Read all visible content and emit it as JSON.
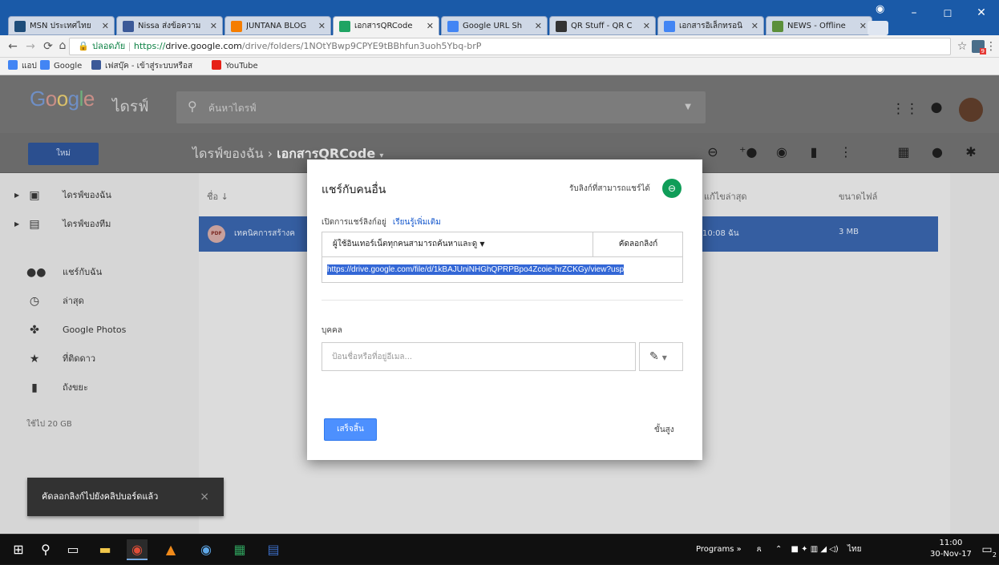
{
  "browser": {
    "tabs": [
      {
        "title": "MSN ประเทศไทย",
        "icon": "msn-icon",
        "color": "#1e4d7a"
      },
      {
        "title": "Nissa ส่งข้อความ",
        "icon": "facebook-icon",
        "color": "#3b5998"
      },
      {
        "title": "JUNTANA BLOG",
        "icon": "blogger-icon",
        "color": "#f57d00"
      },
      {
        "title": "เอกสารQRCode",
        "icon": "google-drive-icon",
        "color": "#1fa463",
        "active": true
      },
      {
        "title": "Google URL Sh",
        "icon": "google-icon",
        "color": "#4285f4"
      },
      {
        "title": "QR Stuff - QR C",
        "icon": "qrstuff-icon",
        "color": "#333333"
      },
      {
        "title": "เอกสารอิเล็กทรอนิ",
        "icon": "google-icon",
        "color": "#4285f4"
      },
      {
        "title": "NEWS - Offline",
        "icon": "news-icon",
        "color": "#5b8f3a"
      }
    ],
    "url": {
      "secure_label": "ปลอดภัย",
      "scheme": "https://",
      "host": "drive.google.com",
      "path": "/drive/folders/1NOtYBwp9CPYE9tBBhfun3uoh5Ybq-brP"
    },
    "bookmarks": [
      {
        "label": "แอป",
        "icon": "apps-grid-icon",
        "color": "#4285f4"
      },
      {
        "label": "Google",
        "icon": "google-icon",
        "color": "#4285f4"
      },
      {
        "label": "เฟสบุ๊ค - เข้าสู่ระบบหรือส",
        "icon": "facebook-icon",
        "color": "#3b5998"
      },
      {
        "label": "YouTube",
        "icon": "youtube-icon",
        "color": "#e62117"
      }
    ]
  },
  "drive": {
    "brand": "ไดรฟ์",
    "logo": {
      "g": "G",
      "o1": "o",
      "o2": "o",
      "g2": "g",
      "l": "l",
      "e": "e"
    },
    "search_placeholder": "ค้นหาไดรฟ์",
    "new_button": "ใหม่",
    "breadcrumb_root": "ไดรฟ์ของฉัน",
    "breadcrumb_sep": "›",
    "breadcrumb_current": "เอกสารQRCode",
    "sidebar": [
      {
        "label": "ไดรฟ์ของฉัน",
        "icon": "my-drive-icon",
        "expand": true
      },
      {
        "label": "ไดรฟ์ของทีม",
        "icon": "team-drive-icon",
        "expand": true
      },
      {
        "label": "แชร์กับฉัน",
        "icon": "shared-with-me-icon"
      },
      {
        "label": "ล่าสุด",
        "icon": "recent-clock-icon"
      },
      {
        "label": "Google Photos",
        "icon": "google-photos-icon"
      },
      {
        "label": "ที่ติดดาว",
        "icon": "starred-icon"
      },
      {
        "label": "ถังขยะ",
        "icon": "trash-icon"
      }
    ],
    "storage": "ใช้ไป 20 GB",
    "columns": {
      "name": "ชื่อ",
      "sort_arrow": "↓",
      "modified": "แก้ไขล่าสุด",
      "size": "ขนาดไฟล์"
    },
    "file": {
      "name": "เทคนิคการสร้างค",
      "type_badge": "PDF",
      "modified": "10:08 ฉัน",
      "size": "3 MB"
    },
    "toast": {
      "message": "คัดลอกลิงก์ไปยังคลิปบอร์ดแล้ว",
      "close": "×"
    }
  },
  "dialog": {
    "title": "แชร์กับคนอื่น",
    "get_link": "รับลิงก์ที่สามารถแชร์ได้",
    "share_state": "เปิดการแชร์ลิงก์อยู่",
    "learn_more": "เรียนรู้เพิ่มเติม",
    "access_option": "ผู้ใช้อินเทอร์เน็ตทุกคนสามารถค้นหาและดู",
    "copy_link": "คัดลอกลิงก์",
    "share_url": "https://drive.google.com/file/d/1kBAJUniNHGhQPRPBpo4Zcoie-hrZCKGy/view?usp",
    "people_label": "บุคคล",
    "people_placeholder": "ป้อนชื่อหรือที่อยู่อีเมล...",
    "done_button": "เสร็จสิ้น",
    "advanced": "ขั้นสูง"
  },
  "taskbar": {
    "programs": "Programs",
    "chevron": "»",
    "language": "ไทย",
    "time": "11:00",
    "date": "30-Nov-17",
    "notification_count": "2"
  },
  "colors": {
    "accent": "#4d90fe",
    "selected_row": "#355ea1",
    "link_green": "#0f9d58"
  }
}
